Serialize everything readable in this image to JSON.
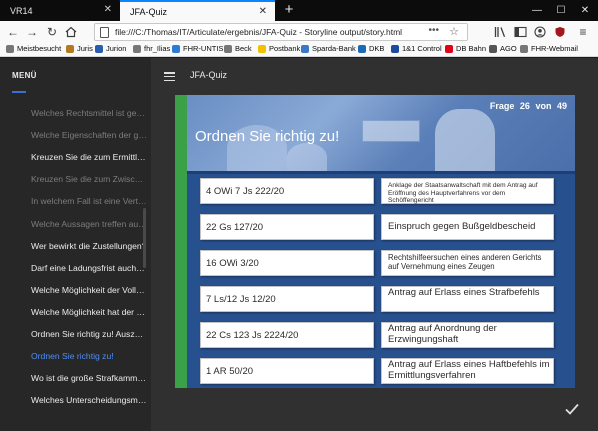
{
  "browser": {
    "tabs": [
      {
        "label": "VR14",
        "close": "✕"
      },
      {
        "label": "JFA-Quiz",
        "close": "✕"
      }
    ],
    "new_tab": "+",
    "window_controls": [
      "—",
      "☐",
      "✕"
    ],
    "url": "file:///C:/Thomas/IT/Articulate/ergebnis/JFA-Quiz - Storyline output/story.html",
    "url_more": "•••",
    "bookmarks": [
      {
        "label": "Meistbesucht",
        "icon_color": "#777777"
      },
      {
        "label": "Juris",
        "icon_color": "#b57a1e"
      },
      {
        "label": "Jurion",
        "icon_color": "#2a5db0"
      },
      {
        "label": "fhr_Ilias",
        "icon_color": "#777777"
      },
      {
        "label": "FHR-UNTIS",
        "icon_color": "#2c7bd6"
      },
      {
        "label": "Beck",
        "icon_color": "#777777"
      },
      {
        "label": "Postbank",
        "icon_color": "#f2c200"
      },
      {
        "label": "Sparda-Bank",
        "icon_color": "#3a78c8"
      },
      {
        "label": "DKB",
        "icon_color": "#1b6ab8"
      },
      {
        "label": "1&1 Control",
        "icon_color": "#1c4ca0"
      },
      {
        "label": "DB Bahn",
        "icon_color": "#e2001a"
      },
      {
        "label": "AGO",
        "icon_color": "#555555"
      },
      {
        "label": "FHR-Webmail",
        "icon_color": "#777777"
      }
    ]
  },
  "sidebar": {
    "title": "MENÜ",
    "items": [
      {
        "label": "Welches Rechtsmittel ist gegen d...",
        "state": "dim"
      },
      {
        "label": "Welche Eigenschaften der großen...",
        "state": "dim"
      },
      {
        "label": "Kreuzen Sie die zum Ermittlungsv...",
        "state": "bright"
      },
      {
        "label": "Kreuzen Sie die zum Zwischenver...",
        "state": "dim"
      },
      {
        "label": "In welchem Fall ist eine Vertretun...",
        "state": "dim"
      },
      {
        "label": "Welche Aussagen treffen auf die ...",
        "state": "dim"
      },
      {
        "label": "Wer bewirkt die Zustellungen?",
        "state": "bright"
      },
      {
        "label": "Darf eine Ladungsfrist auch an ei...",
        "state": "bright"
      },
      {
        "label": "Welche Möglichkeit der Vollstrec...",
        "state": "bright"
      },
      {
        "label": "Welche Möglichkeit hat der Besc...",
        "state": "bright"
      },
      {
        "label": "Ordnen Sie richtig zu! Auszüge au...",
        "state": "bright"
      },
      {
        "label": "Ordnen Sie richtig zu!",
        "state": "active"
      },
      {
        "label": "Wo ist die große Strafkammer als ...",
        "state": "bright"
      },
      {
        "label": "Welches Unterscheidungsmerkm...",
        "state": "bright"
      }
    ]
  },
  "main": {
    "course_title": "JFA-Quiz",
    "slide": {
      "title": "Ordnen Sie richtig zu!",
      "counter_prefix": "Frage",
      "current": "26",
      "counter_sep": "von",
      "total": "49"
    },
    "left_cards": [
      "4 OWi 7 Js 222/20",
      "22 Gs 127/20",
      "16 OWi 3/20",
      "7 Ls/12 Js 12/20",
      "22 Cs 123 Js 2224/20",
      "1 AR 50/20"
    ],
    "right_cards": [
      "Anklage der Staatsanwaltschaft mit dem Antrag auf Eröffnung des Hauptverfahrens vor dem Schöffengericht",
      "Einspruch gegen Bußgeldbescheid",
      "Rechtshilfeersuchen eines anderen Gerichts auf Vernehmung eines Zeugen",
      "Antrag auf Erlass eines Strafbefehls",
      "Antrag auf Anordnung der Erzwingungshaft",
      "Antrag auf Erlass eines Haftbefehls im Ermittlungsverfahren"
    ],
    "colors": {
      "slide_bg": "#27508e",
      "accent_green": "#3aa148",
      "active_menu": "#4d8ef7"
    }
  }
}
